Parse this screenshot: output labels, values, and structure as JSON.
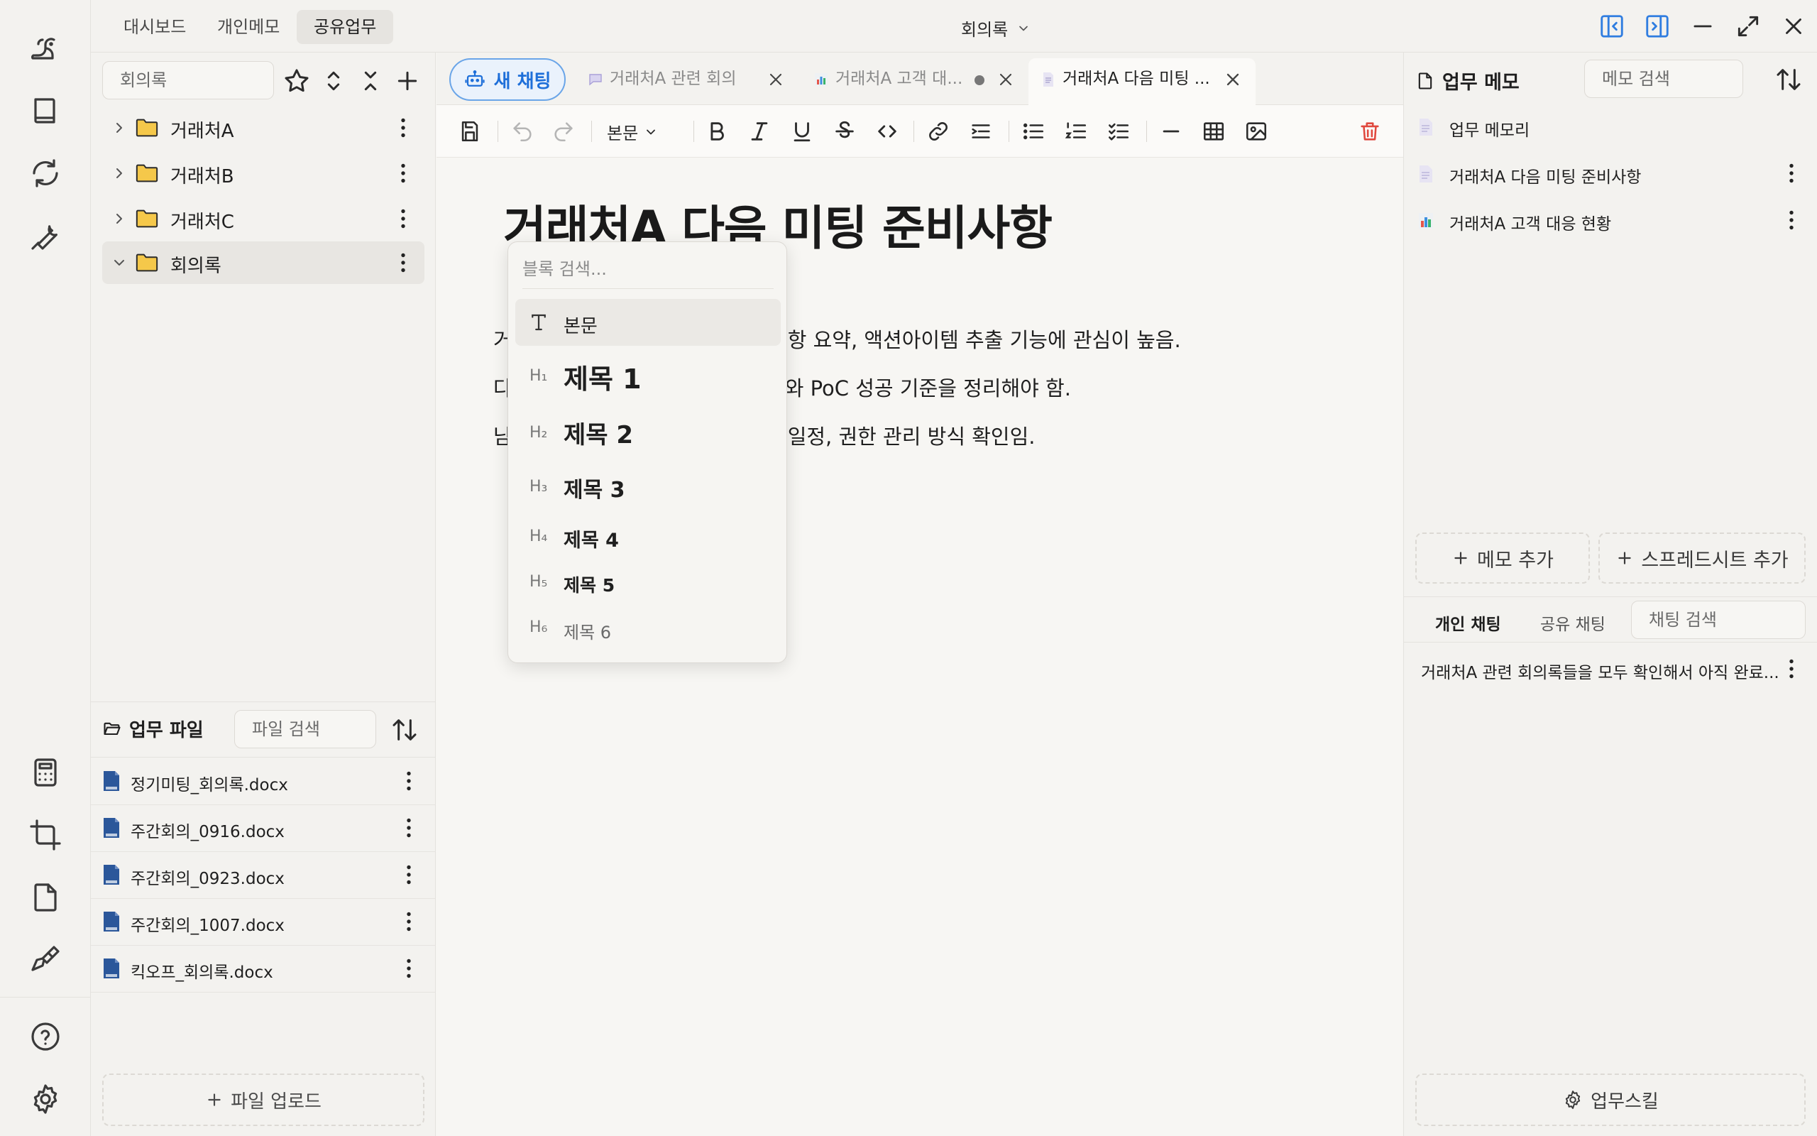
{
  "topnav": {
    "tabs": [
      {
        "label": "대시보드"
      },
      {
        "label": "개인메모"
      },
      {
        "label": "공유업무"
      }
    ],
    "center_title": "회의록"
  },
  "leftpanel": {
    "search": {
      "placeholder": "회의록"
    },
    "tree": [
      {
        "label": "거래처A"
      },
      {
        "label": "거래처B"
      },
      {
        "label": "거래처C"
      },
      {
        "label": "회의록"
      }
    ],
    "files": {
      "title": "업무 파일",
      "search_placeholder": "파일 검색",
      "items": [
        {
          "name": "정기미팅_회의록.docx"
        },
        {
          "name": "주간회의_0916.docx"
        },
        {
          "name": "주간회의_0923.docx"
        },
        {
          "name": "주간회의_1007.docx"
        },
        {
          "name": "킥오프_회의록.docx"
        }
      ],
      "upload_label": "파일 업로드"
    }
  },
  "editor": {
    "new_chat_label": "새 채팅",
    "tabs": [
      {
        "title": "거래처A 관련 회의"
      },
      {
        "title": "거래처A 고객 대..."
      },
      {
        "title": "거래처A 다음 미팅 ..."
      }
    ],
    "toolbar": {
      "style_label": "본문"
    },
    "doc_title": "거래처A 다음 미팅 준비사항",
    "paragraphs": [
      {
        "prefix": "거",
        "suffix": "항 요약, 액션아이템 추출 기능에 관심이 높음."
      },
      {
        "prefix": "다",
        "suffix": "와 PoC 성공 기준을 정리해야 함."
      },
      {
        "prefix": "남",
        "suffix": "일정, 권한 관리 방식 확인임."
      }
    ],
    "block_menu": {
      "search_placeholder": "블록 검색...",
      "items": [
        {
          "tag": "T",
          "label": "본문"
        },
        {
          "tag": "H₁",
          "label": "제목 1"
        },
        {
          "tag": "H₂",
          "label": "제목 2"
        },
        {
          "tag": "H₃",
          "label": "제목 3"
        },
        {
          "tag": "H₄",
          "label": "제목 4"
        },
        {
          "tag": "H₅",
          "label": "제목 5"
        },
        {
          "tag": "H₆",
          "label": "제목 6"
        }
      ]
    }
  },
  "rightpanel": {
    "title": "업무 메모",
    "search_placeholder": "메모 검색",
    "memos": [
      {
        "label": "업무 메모리"
      },
      {
        "label": "거래처A 다음 미팅 준비사항"
      },
      {
        "label": "거래처A 고객 대응 현황"
      }
    ],
    "add_memo_label": "메모 추가",
    "add_sheet_label": "스프레드시트 추가",
    "chat_tabs": [
      {
        "label": "개인 채팅"
      },
      {
        "label": "공유 채팅"
      }
    ],
    "chat_search_placeholder": "채팅 검색",
    "chats": [
      {
        "label": "거래처A 관련 회의록들을 모두 확인해서 아직 완료..."
      }
    ],
    "skill_label": "업무스킬"
  },
  "colors": {
    "accent_blue": "#1e6fd9",
    "folder_yellow": "#f5c84a",
    "danger_red": "#e0483e",
    "docx_blue": "#2b579a"
  }
}
